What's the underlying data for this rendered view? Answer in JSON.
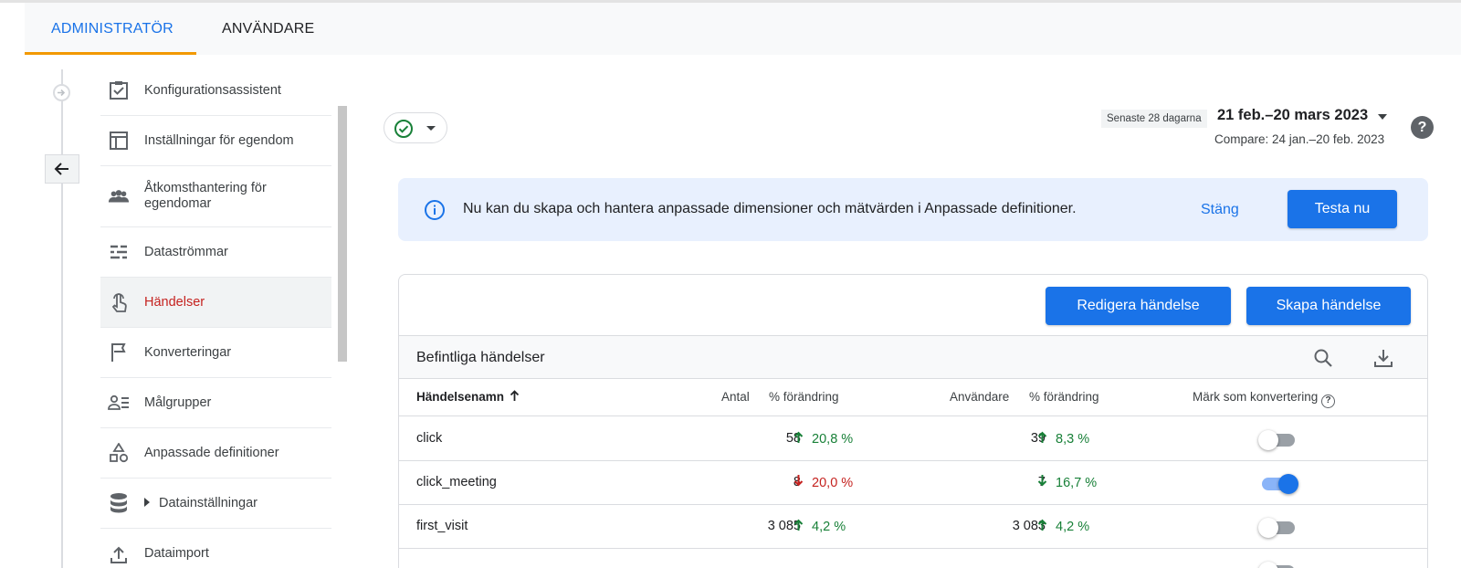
{
  "tabs": {
    "admin": "ADMINISTRATÖR",
    "users": "ANVÄNDARE"
  },
  "sidebar": {
    "items": [
      {
        "label": "Konfigurationsassistent",
        "icon": "checklist-icon"
      },
      {
        "label": "Inställningar för egendom",
        "icon": "layout-icon"
      },
      {
        "label": "Åtkomsthantering för egendomar",
        "icon": "people-icon"
      },
      {
        "label": "Dataströmmar",
        "icon": "streams-icon"
      },
      {
        "label": "Händelser",
        "icon": "touch-icon",
        "active": true
      },
      {
        "label": "Konverteringar",
        "icon": "flag-icon"
      },
      {
        "label": "Målgrupper",
        "icon": "audience-icon"
      },
      {
        "label": "Anpassade definitioner",
        "icon": "shapes-icon"
      },
      {
        "label": "Datainställningar",
        "icon": "database-icon"
      },
      {
        "label": "Dataimport",
        "icon": "upload-icon"
      }
    ]
  },
  "date": {
    "badge": "Senaste 28 dagarna",
    "range": "21 feb.–20 mars 2023",
    "compare": "Compare: 24 jan.–20 feb. 2023"
  },
  "banner": {
    "message": "Nu kan du skapa och hantera anpassade dimensioner och mätvärden i Anpassade definitioner.",
    "close": "Stäng",
    "try": "Testa nu"
  },
  "card": {
    "edit": "Redigera händelse",
    "create": "Skapa händelse",
    "title": "Befintliga händelser"
  },
  "table": {
    "headers": {
      "name": "Händelsenamn",
      "count": "Antal",
      "change1": "% förändring",
      "users": "Användare",
      "change2": "% förändring",
      "mark": "Märk som konvertering"
    },
    "rows": [
      {
        "name": "click",
        "count": "58",
        "chg1": "20,8 %",
        "dir1": "up",
        "users": "39",
        "chg2": "8,3 %",
        "dir2": "up",
        "conversion": false
      },
      {
        "name": "click_meeting",
        "count": "8",
        "chg1": "20,0 %",
        "dir1": "down",
        "users": "7",
        "chg2": "16,7 %",
        "dir2": "down",
        "conversion": true
      },
      {
        "name": "first_visit",
        "count": "3 085",
        "chg1": "4,2 %",
        "dir1": "up",
        "users": "3 083",
        "chg2": "4,2 %",
        "dir2": "up",
        "conversion": false
      }
    ]
  },
  "colors": {
    "accent": "#1a73e8",
    "active": "#c5221f",
    "up": "#188038",
    "down": "#c5221f",
    "tabUnderline": "#f29900"
  }
}
